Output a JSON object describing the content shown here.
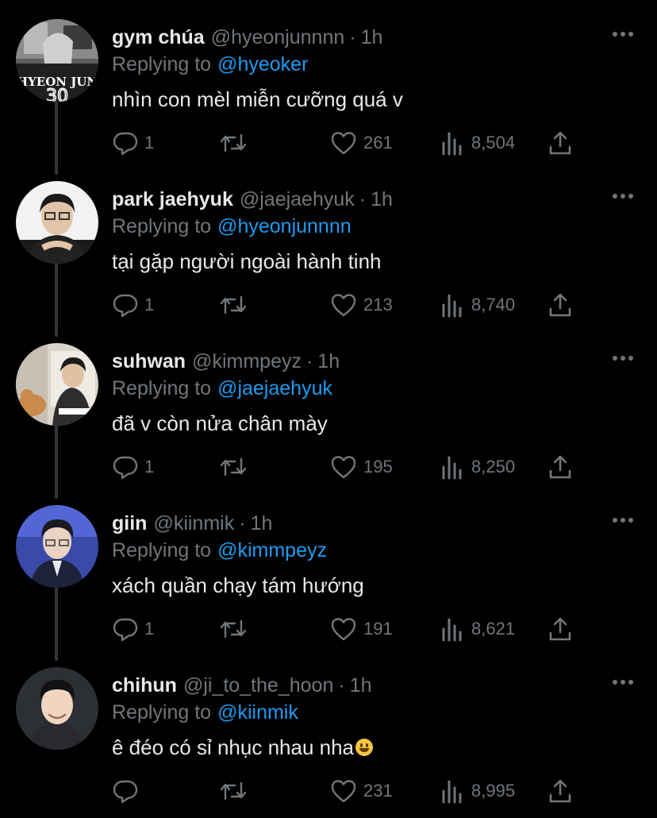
{
  "colors": {
    "background": "#000000",
    "text": "#e7e9ea",
    "secondary": "#71767b",
    "link": "#1d9bf0",
    "thread_line": "#333639"
  },
  "icons": {
    "more": "more-horizontal-icon",
    "reply": "reply-icon",
    "retweet": "retweet-icon",
    "like": "heart-icon",
    "views": "views-icon",
    "share": "share-icon"
  },
  "tweets": [
    {
      "name": "gym chúa",
      "handle": "@hyeonjunnnn",
      "dot": "·",
      "time": "1h",
      "reply_prefix": "Replying to",
      "reply_to": "@hyeoker",
      "text": "nhìn con mèl miễn cưỡng quá v",
      "replies": "1",
      "retweets": "",
      "likes": "261",
      "views": "8,504",
      "avatar_text": "HYEON JUN"
    },
    {
      "name": "park jaehyuk",
      "handle": "@jaejaehyuk",
      "dot": "·",
      "time": "1h",
      "reply_prefix": "Replying to",
      "reply_to": "@hyeonjunnnn",
      "text": "tại gặp người ngoài hành tinh",
      "replies": "1",
      "retweets": "",
      "likes": "213",
      "views": "8,740"
    },
    {
      "name": "suhwan",
      "handle": "@kimmpeyz",
      "dot": "·",
      "time": "1h",
      "reply_prefix": "Replying to",
      "reply_to": "@jaejaehyuk",
      "text": "đã v còn nửa chân mày",
      "replies": "1",
      "retweets": "",
      "likes": "195",
      "views": "8,250"
    },
    {
      "name": "giin",
      "handle": "@kiinmik",
      "dot": "·",
      "time": "1h",
      "reply_prefix": "Replying to",
      "reply_to": "@kimmpeyz",
      "text": "xách quần chạy tám hướng",
      "replies": "1",
      "retweets": "",
      "likes": "191",
      "views": "8,621"
    },
    {
      "name": "chihun",
      "handle": "@ji_to_the_hoon",
      "dot": "·",
      "time": "1h",
      "reply_prefix": "Replying to",
      "reply_to": "@kiinmik",
      "text": "ê đéo có sỉ nhục nhau nha",
      "emoji": "grinning-face-emoji",
      "replies": "",
      "retweets": "",
      "likes": "231",
      "views": "8,995"
    }
  ]
}
